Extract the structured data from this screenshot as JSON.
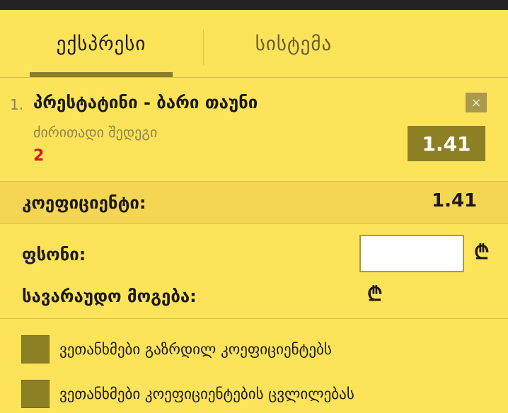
{
  "tabs": [
    {
      "label": "ექსპრესი",
      "active": true
    },
    {
      "label": "სისტემა",
      "active": false
    }
  ],
  "bet": {
    "index": "1.",
    "match": "პრესტატინი - ბარი თაუნი",
    "market": "ძირითადი შედეგი",
    "pick": "2",
    "odd": "1.41",
    "remove_symbol": "×"
  },
  "coefficient": {
    "label": "კოეფიციენტი:",
    "value": "1.41"
  },
  "stake": {
    "label": "ფსონი:",
    "value": "",
    "currency": "₾"
  },
  "possible_win": {
    "label": "სავარაუდო მოგება:",
    "currency": "₾"
  },
  "options": [
    {
      "label": "ვეთანხმები გაზრდილ კოეფიციენტებს",
      "checked": false
    },
    {
      "label": "ვეთანხმები კოეფიციენტების ცვლილებას",
      "checked": false
    }
  ],
  "colors": {
    "background": "#fde359",
    "accent": "#8c7f24",
    "pick": "#d6181e"
  }
}
